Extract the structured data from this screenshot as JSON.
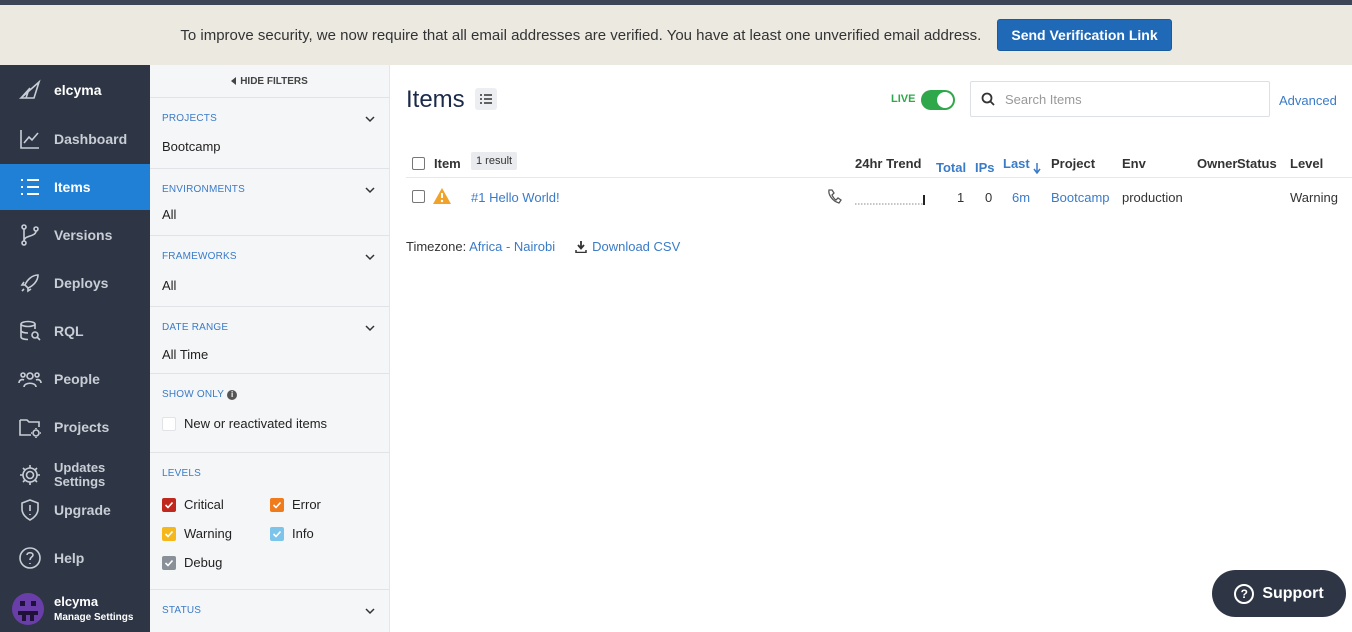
{
  "banner": {
    "message": "To improve security, we now require that all email addresses are verified. You have at least one unverified email address.",
    "button_label": "Send Verification Link",
    "button_color": "#1f69b6"
  },
  "nav": {
    "brand": "elcyma",
    "items": [
      {
        "label": "Dashboard",
        "icon": "chart-line-icon"
      },
      {
        "label": "Items",
        "icon": "list-icon",
        "active": true
      },
      {
        "label": "Versions",
        "icon": "branch-icon"
      },
      {
        "label": "Deploys",
        "icon": "rocket-icon"
      },
      {
        "label": "RQL",
        "icon": "database-search-icon"
      },
      {
        "label": "People",
        "icon": "people-icon"
      },
      {
        "label": "Projects",
        "icon": "folder-gear-icon"
      },
      {
        "label_line1": "Updates",
        "label_line2": "Settings",
        "icon": "gear-icon"
      },
      {
        "label": "Upgrade",
        "icon": "shield-icon"
      },
      {
        "label": "Help",
        "icon": "help-circle-icon"
      }
    ],
    "user": {
      "name": "elcyma",
      "sub": "Manage Settings"
    },
    "active_color": "#1f80d6",
    "bg_color": "#2e3645"
  },
  "filters": {
    "hide_label": "HIDE FILTERS",
    "projects": {
      "title": "PROJECTS",
      "value": "Bootcamp"
    },
    "environments": {
      "title": "ENVIRONMENTS",
      "value": "All"
    },
    "frameworks": {
      "title": "FRAMEWORKS",
      "value": "All"
    },
    "date_range": {
      "title": "DATE RANGE",
      "value": "All Time"
    },
    "show_only": {
      "title": "SHOW ONLY",
      "option": "New or reactivated items"
    },
    "levels": {
      "title": "LEVELS",
      "items": [
        {
          "label": "Critical",
          "color": "#c0281d"
        },
        {
          "label": "Error",
          "color": "#f07b1d"
        },
        {
          "label": "Warning",
          "color": "#f5b81c"
        },
        {
          "label": "Info",
          "color": "#7cc4ea"
        },
        {
          "label": "Debug",
          "color": "#8a9098"
        }
      ]
    },
    "status": {
      "title": "STATUS"
    }
  },
  "main": {
    "title": "Items",
    "live_label": "LIVE",
    "search_placeholder": "Search Items",
    "advanced_label": "Advanced",
    "columns": {
      "item": "Item",
      "result_count": "1 result",
      "trend": "24hr Trend",
      "total": "Total",
      "ips": "IPs",
      "last": "Last",
      "project": "Project",
      "env": "Env",
      "owner": "Owner",
      "status": "Status",
      "level": "Level"
    },
    "rows": [
      {
        "title": "#1 Hello World!",
        "total": "1",
        "ips": "0",
        "last": "6m",
        "project": "Bootcamp",
        "env": "production",
        "level": "Warning"
      }
    ],
    "timezone_label": "Timezone:",
    "timezone_value": "Africa - Nairobi",
    "download_label": "Download CSV"
  },
  "support": {
    "label": "Support"
  }
}
